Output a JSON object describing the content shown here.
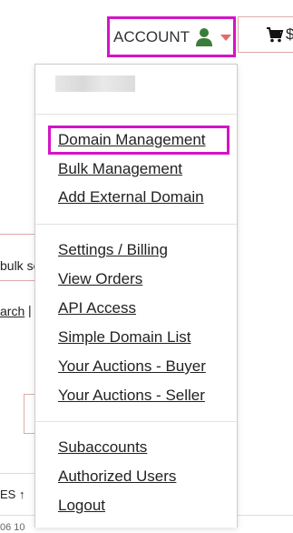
{
  "header": {
    "account_label": "ACCOUNT",
    "cart_fragment": "$",
    "icons": {
      "user": "user-icon",
      "caret": "caret-down-icon",
      "cart": "shopping-cart-icon"
    },
    "colors": {
      "highlight": "#d414c5",
      "user_icon": "#3a7d3a",
      "caret": "#e36a6a",
      "border": "#e0a9a9"
    }
  },
  "background": {
    "bulk_fragment": "bulk se",
    "search_fragment": "arch",
    "pipe": "|",
    "sort_label": "ES",
    "sort_arrow": "↑",
    "bottom_fragment": "06 10"
  },
  "menu": {
    "groups": [
      [
        {
          "label": "Domain Management"
        },
        {
          "label": "Bulk Management"
        },
        {
          "label": "Add External Domain"
        }
      ],
      [
        {
          "label": "Settings / Billing"
        },
        {
          "label": "View Orders"
        },
        {
          "label": "API Access"
        },
        {
          "label": "Simple Domain List"
        },
        {
          "label": "Your Auctions - Buyer"
        },
        {
          "label": "Your Auctions - Seller"
        }
      ],
      [
        {
          "label": "Subaccounts"
        },
        {
          "label": "Authorized Users"
        },
        {
          "label": "Logout"
        }
      ]
    ]
  }
}
